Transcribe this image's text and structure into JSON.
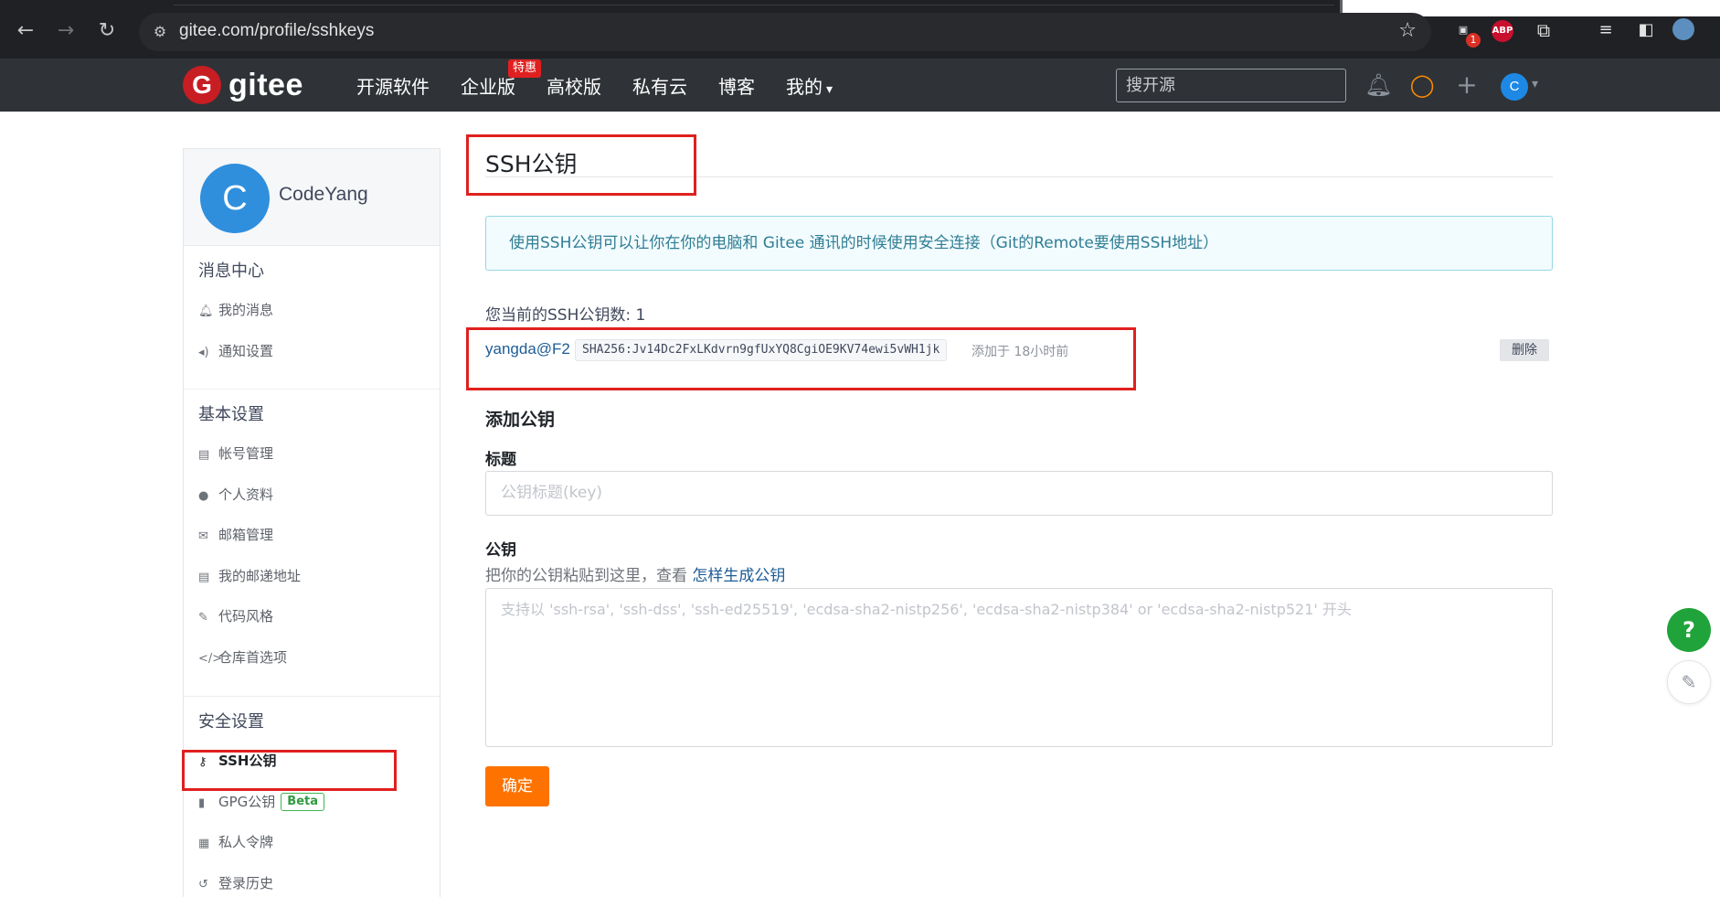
{
  "browser": {
    "url": "gitee.com/profile/sshkeys",
    "ext_badge_count": "1",
    "abp_label": "ABP"
  },
  "header": {
    "logo_letter": "G",
    "logo_text": "gitee",
    "nav": [
      "开源软件",
      "企业版",
      "高校版",
      "私有云",
      "博客",
      "我的"
    ],
    "promo_badge": "特惠",
    "search_placeholder": "搜开源",
    "avatar_letter": "C"
  },
  "sidebar": {
    "avatar_letter": "C",
    "username": "CodeYang",
    "sections": [
      {
        "title": "消息中心",
        "items": [
          "我的消息",
          "通知设置"
        ]
      },
      {
        "title": "基本设置",
        "items": [
          "帐号管理",
          "个人资料",
          "邮箱管理",
          "我的邮递地址",
          "代码风格",
          "仓库首选项"
        ]
      },
      {
        "title": "安全设置",
        "items": [
          "SSH公钥",
          "GPG公钥",
          "私人令牌",
          "登录历史"
        ]
      }
    ],
    "beta_label": "Beta",
    "active_item": "SSH公钥"
  },
  "main": {
    "title": "SSH公钥",
    "info": "使用SSH公钥可以让你在你的电脑和 Gitee 通讯的时候使用安全连接（Git的Remote要使用SSH地址）",
    "count_text": "您当前的SSH公钥数: 1",
    "key": {
      "name": "yangda@F2",
      "fingerprint": "SHA256:Jv14Dc2FxLKdvrn9gfUxYQ8CgiOE9KV74ewi5vWH1jk",
      "added": "添加于 18小时前",
      "delete_label": "删除"
    },
    "add_heading": "添加公钥",
    "title_label": "标题",
    "title_placeholder": "公钥标题(key)",
    "key_label": "公钥",
    "hint_text": "把你的公钥粘贴到这里，查看 ",
    "hint_link": "怎样生成公钥",
    "key_placeholder": "支持以 'ssh-rsa', 'ssh-dss', 'ssh-ed25519', 'ecdsa-sha2-nistp256', 'ecdsa-sha2-nistp384' or 'ecdsa-sha2-nistp521' 开头",
    "submit_label": "确定"
  },
  "floating": {
    "help_label": "?"
  },
  "colors": {
    "header_bg": "#2f3337",
    "brand_red": "#c71d23",
    "submit_orange": "#fe7300",
    "link_blue": "#1d5c96",
    "highlight_red": "#e0201e",
    "help_green": "#1fa33a"
  }
}
